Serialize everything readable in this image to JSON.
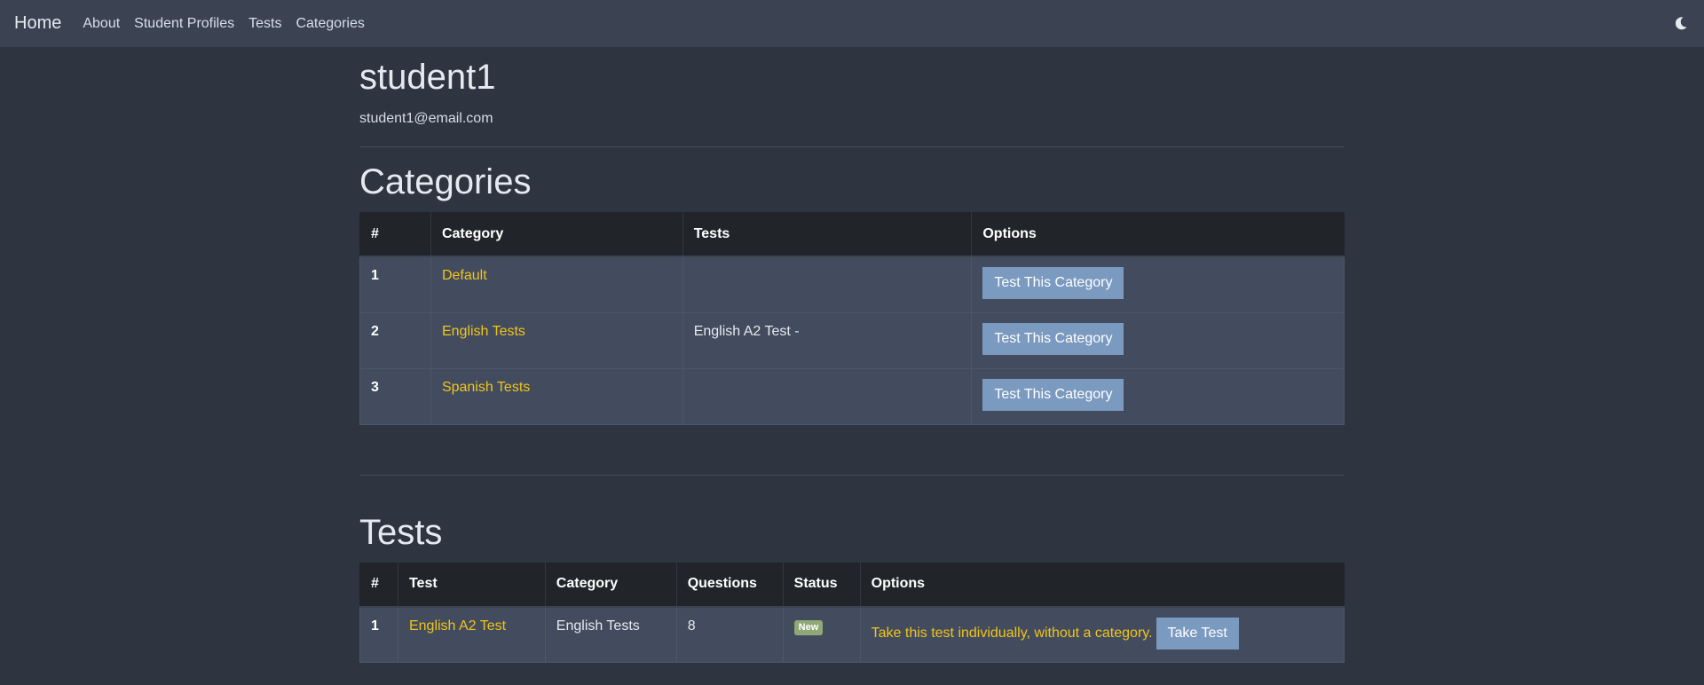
{
  "navbar": {
    "brand": "Home",
    "links": [
      "About",
      "Student Profiles",
      "Tests",
      "Categories"
    ],
    "theme_icon": "moon-icon"
  },
  "profile": {
    "name": "student1",
    "email": "student1@email.com"
  },
  "categories": {
    "title": "Categories",
    "headers": [
      "#",
      "Category",
      "Tests",
      "Options"
    ],
    "rows": [
      {
        "num": "1",
        "category": "Default",
        "tests": "",
        "option": "Test This Category"
      },
      {
        "num": "2",
        "category": "English Tests",
        "tests": "English A2 Test -",
        "option": "Test This Category"
      },
      {
        "num": "3",
        "category": "Spanish Tests",
        "tests": "",
        "option": "Test This Category"
      }
    ]
  },
  "tests": {
    "title": "Tests",
    "headers": [
      "#",
      "Test",
      "Category",
      "Questions",
      "Status",
      "Options"
    ],
    "rows": [
      {
        "num": "1",
        "test": "English A2 Test",
        "category": "English Tests",
        "questions": "8",
        "status": "New",
        "option_text": "Take this test individually, without a category.",
        "option_button": "Take Test"
      }
    ]
  },
  "colors": {
    "background": "#2e3440",
    "navbar": "#3b4252",
    "link": "#f0c419",
    "button": "#7b9ac0",
    "badge": "#8fa876",
    "table_header": "#212529",
    "table_row": "#434c5e"
  }
}
